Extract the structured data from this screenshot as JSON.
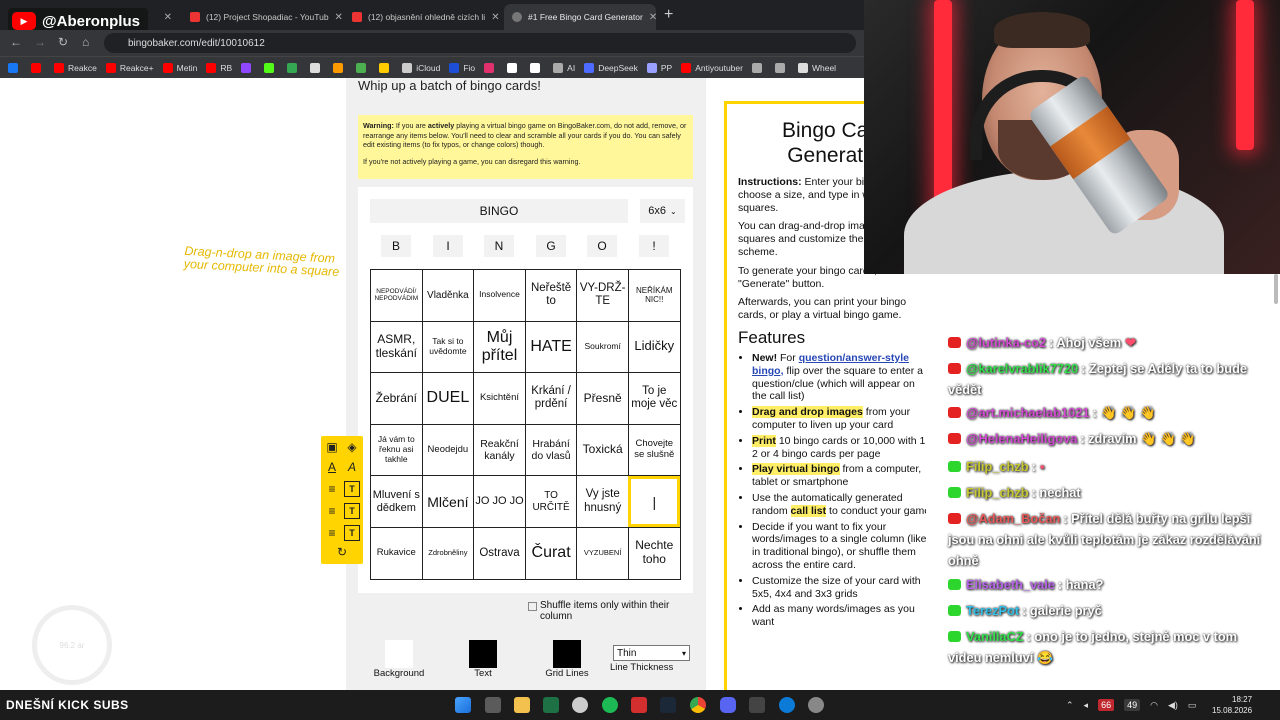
{
  "browser": {
    "tabs": [
      {
        "title": ""
      },
      {
        "title": "(12) Project Shopadiac - YouTub"
      },
      {
        "title": "(12) objasnění ohledně cizích li"
      },
      {
        "title": "#1 Free Bingo Card Generator",
        "active": true
      }
    ],
    "new_tab": "+",
    "url": "bingobaker.com/edit/10010612",
    "bookmarks": [
      {
        "label": "",
        "color": "#1877f2"
      },
      {
        "label": "",
        "color": "#ff0000"
      },
      {
        "label": "Reakce",
        "color": "#ff0000"
      },
      {
        "label": "Reakce+",
        "color": "#ff0000"
      },
      {
        "label": "Metin",
        "color": "#ff0000"
      },
      {
        "label": "RB",
        "color": "#ff0000"
      },
      {
        "label": "",
        "color": "#9146ff"
      },
      {
        "label": "",
        "color": "#53fc18"
      },
      {
        "label": "",
        "color": "#34a853"
      },
      {
        "label": "",
        "color": "#dddddd"
      },
      {
        "label": "",
        "color": "#ff9900"
      },
      {
        "label": "",
        "color": "#4caf50"
      },
      {
        "label": "",
        "color": "#ffcc00"
      },
      {
        "label": "iCloud",
        "color": "#cccccc"
      },
      {
        "label": "Fio",
        "color": "#1d4ed8"
      },
      {
        "label": "",
        "color": "#e1306c"
      },
      {
        "label": "",
        "color": "#ffffff"
      },
      {
        "label": "",
        "color": "#ffffff"
      },
      {
        "label": "AI",
        "color": "#aaaaaa"
      },
      {
        "label": "DeepSeek",
        "color": "#4d6bfe"
      },
      {
        "label": "PP",
        "color": "#9aa0ff"
      },
      {
        "label": "Antiyoutuber",
        "color": "#ff0000"
      },
      {
        "label": "",
        "color": "#aaaaaa"
      },
      {
        "label": "",
        "color": "#aaaaaa"
      },
      {
        "label": "Wheel",
        "color": "#dddddd"
      }
    ]
  },
  "overlay": {
    "channel_name": "@Aberonplus",
    "youtube_icon": "youtube-icon",
    "bottom_label": "DNEŠNÍ KICK SUBS",
    "drag_hint": "Drag-n-drop an image from your computer into a square",
    "circle_text": "96.2 ar"
  },
  "page": {
    "heading": "Whip up a batch of bingo cards!",
    "warning": {
      "bold_lead": "Warning:",
      "text_before_active": " If you are ",
      "active_word": "actively",
      "text_after_active": " playing a virtual bingo game on BingoBaker.com, do not add, remove, or rearrange any items below. You'll need to clear and scramble all your cards if you do. You can safely edit existing items (to fix typos, or change colors) though.",
      "second_para": "If you're not actively playing a game, you can disregard this warning."
    },
    "card": {
      "title": "BINGO",
      "size": "6x6",
      "letters": [
        "B",
        "I",
        "N",
        "G",
        "O",
        "!"
      ],
      "cells": [
        [
          {
            "text": "NEPODVÁDÍ/ NEPODVÁDIM",
            "size": 6.5
          },
          {
            "text": "Vladěnka",
            "size": 10
          },
          {
            "text": "Insolvence",
            "size": 8.5
          },
          {
            "text": "Neřeště to",
            "size": 11.5
          },
          {
            "text": "VY-DRŽ-TE",
            "size": 11.5
          },
          {
            "text": "NEŘÍKÁM NIC!!",
            "size": 8
          }
        ],
        [
          {
            "text": "ASMR, tleskání",
            "size": 12
          },
          {
            "text": "Tak si to uvědomte",
            "size": 8.5
          },
          {
            "text": "Můj přítel",
            "size": 16
          },
          {
            "text": "HATE",
            "size": 16
          },
          {
            "text": "Soukromí",
            "size": 8.5
          },
          {
            "text": "Lidičky",
            "size": 13
          }
        ],
        [
          {
            "text": "Žebrání",
            "size": 12
          },
          {
            "text": "DUEL",
            "size": 16
          },
          {
            "text": "Ksichtění",
            "size": 9.5
          },
          {
            "text": "Krkání / prdění",
            "size": 11.5
          },
          {
            "text": "Přesně",
            "size": 12
          },
          {
            "text": "To je moje věc",
            "size": 11.5
          }
        ],
        [
          {
            "text": "Já vám to řeknu asi takhle",
            "size": 8.5
          },
          {
            "text": "Neodejdu",
            "size": 9.5
          },
          {
            "text": "Reakční kanály",
            "size": 10.5
          },
          {
            "text": "Hrabání do vlasů",
            "size": 10.5
          },
          {
            "text": "Toxická",
            "size": 12
          },
          {
            "text": "Chovejte se slušně",
            "size": 9.5
          }
        ],
        [
          {
            "text": "Mluvení s dědkem",
            "size": 11
          },
          {
            "text": "Mlčení",
            "size": 14
          },
          {
            "text": "JO JO JO",
            "size": 11
          },
          {
            "text": "TO URČITĚ",
            "size": 10
          },
          {
            "text": "Vy jste hnusný",
            "size": 11.5
          },
          {
            "text": "|",
            "size": 14
          }
        ],
        [
          {
            "text": "Rukavice",
            "size": 9.5
          },
          {
            "text": "Zdrobněliny",
            "size": 7.5
          },
          {
            "text": "Ostrava",
            "size": 11.5
          },
          {
            "text": "Čurat",
            "size": 16
          },
          {
            "text": "VYZUBENÍ",
            "size": 7.5
          },
          {
            "text": "Nechte toho",
            "size": 12
          }
        ]
      ]
    },
    "shuffle_label": "Shuffle items only within their column",
    "controls": {
      "background_label": "Background",
      "background_color": "#ffffff",
      "text_label": "Text",
      "text_color": "#000000",
      "grid_label": "Grid Lines",
      "grid_color": "#000000",
      "thickness_value": "Thin",
      "thickness_label": "Line Thickness"
    },
    "generator": {
      "title": "Bingo Card Generator",
      "instructions_lead": "Instructions:",
      "instructions_text": " Enter your bingo title, choose a size, and type in words into the squares.",
      "para2": "You can drag-and-drop images into the squares and customize the color scheme.",
      "para3": "To generate your bingo cards, click the \"Generate\" button.",
      "para4": "Afterwards, you can print your bingo cards, or play a virtual bingo game.",
      "features_title": "Features",
      "features": [
        {
          "lead": "New!",
          "link": "question/answer-style bingo,",
          "rest": " flip over the square to enter a question/clue (which will appear on the call list)"
        },
        {
          "hl": "Drag and drop images",
          "rest": " from your computer to liven up your card"
        },
        {
          "hl": "Print",
          "rest": " 10 bingo cards or 10,000 with 1, 2 or 4 bingo cards per page"
        },
        {
          "hl": "Play virtual bingo",
          "rest": " from a computer, tablet or smartphone"
        },
        {
          "pre": "Use the automatically generated random ",
          "hl": "call list",
          "rest": " to conduct your game"
        },
        {
          "rest": "Decide if you want to fix your words/images to a single column (like in traditional bingo), or shuffle them across the entire card."
        },
        {
          "rest": "Customize the size of your card with 5x5, 4x4 and 3x3 grids"
        },
        {
          "rest": "Add as many words/images as you want"
        }
      ]
    }
  },
  "chat": {
    "messages": [
      {
        "platform": "yt",
        "user": "@lutinka-co2",
        "user_color": "#d24bd2",
        "text": ": Ahoj všem",
        "emoji": "❤"
      },
      {
        "platform": "yt",
        "user": "@karelvrablik7720",
        "user_color": "#33e04b",
        "text": ": Zeptej se Adély ta to bude vědět",
        "emoji": ""
      },
      {
        "platform": "yt",
        "user": "@art.michaelab1021",
        "user_color": "#d24bd2",
        "text": ":",
        "emoji": "👋 👋 👋"
      },
      {
        "platform": "yt",
        "user": "@HelenaHeiligova",
        "user_color": "#d24bd2",
        "text": ": zdravím",
        "emoji": "👋 👋 👋"
      },
      {
        "platform": "kick",
        "user": "Filip_chzb",
        "user_color": "#c7c932",
        "text": ":",
        "emoji": "▪"
      },
      {
        "platform": "kick",
        "user": "Filip_chzb",
        "user_color": "#c7c932",
        "text": ": nechat",
        "emoji": ""
      },
      {
        "platform": "yt",
        "user": "@Adam_Bočan",
        "user_color": "#e85a5a",
        "text": ": Přítel dělá buřty na grilu lepší jsou na ohni ale kvůli teplotám je zákaz rozdělávání ohně",
        "emoji": ""
      },
      {
        "platform": "kick",
        "user": "Elisabeth_vale",
        "user_color": "#b765e8",
        "text": ": hana?",
        "emoji": ""
      },
      {
        "platform": "kick",
        "user": "TerezPot",
        "user_color": "#33c0e8",
        "text": ": galerie pryč",
        "emoji": ""
      },
      {
        "platform": "kick",
        "user": "VanillaCZ",
        "user_color": "#33e04b",
        "text": ": ono je to jedno, stejně moc v tom videu nemluví",
        "emoji": "😂"
      }
    ]
  },
  "taskbar": {
    "tray_badge_1": "66",
    "tray_badge_2": "49",
    "time": "18:27",
    "date": "15.08.2026"
  }
}
